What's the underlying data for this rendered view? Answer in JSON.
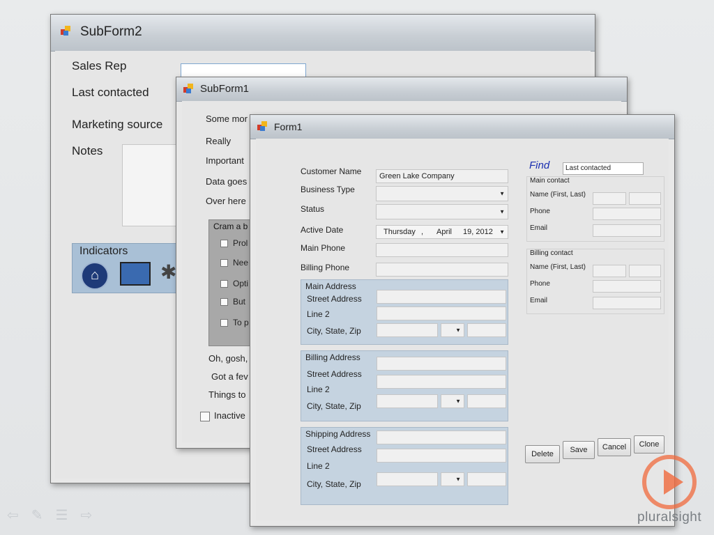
{
  "subform2": {
    "title": "SubForm2",
    "labels": {
      "sales_rep": "Sales Rep",
      "last_contacted": "Last contacted",
      "marketing_source": "Marketing source",
      "notes": "Notes"
    },
    "indicators_title": "Indicators",
    "icons": [
      "home-icon",
      "film-icon",
      "network-icon"
    ]
  },
  "subform1": {
    "title": "SubForm1",
    "labels": [
      "Some mor",
      "Really",
      "Important",
      "Data goes",
      "Over here"
    ],
    "group_title": "Cram a b",
    "checkboxes": [
      "Prol",
      "Nee",
      "Opti",
      "But",
      "To p"
    ],
    "lower_labels": [
      "Oh, gosh,",
      "Got a fev",
      "Things to"
    ],
    "inactive_label": "Inactive"
  },
  "form1": {
    "title": "Form1",
    "labels": {
      "customer_name": "Customer Name",
      "business_type": "Business Type",
      "status": "Status",
      "active_date": "Active Date",
      "main_phone": "Main Phone",
      "billing_phone": "Billing Phone"
    },
    "values": {
      "customer_name": "Green Lake Company",
      "active_date_day": "Thursday",
      "active_date_sep": ",",
      "active_date_month": "April",
      "active_date_rest": "19, 2012"
    },
    "addresses": [
      {
        "title": "Main Address",
        "street": "Street Address",
        "line2": "Line 2",
        "city": "City, State, Zip"
      },
      {
        "title": "Billing Address",
        "street": "Street Address",
        "line2": "Line 2",
        "city": "City, State, Zip"
      },
      {
        "title": "Shipping Address",
        "street": "Street Address",
        "line2": "Line 2",
        "city": "City, State, Zip"
      }
    ],
    "find_label": "Find",
    "find_value": "Last contacted",
    "main_contact": {
      "title": "Main contact",
      "name": "Name (First, Last)",
      "phone": "Phone",
      "email": "Email"
    },
    "billing_contact": {
      "title": "Billing contact",
      "name": "Name (First, Last)",
      "phone": "Phone",
      "email": "Email"
    },
    "buttons": {
      "delete": "Delete",
      "save": "Save",
      "cancel": "Cancel",
      "clone": "Clone"
    }
  },
  "brand": {
    "name": "pluralsight",
    "accent": "#f0693c"
  }
}
